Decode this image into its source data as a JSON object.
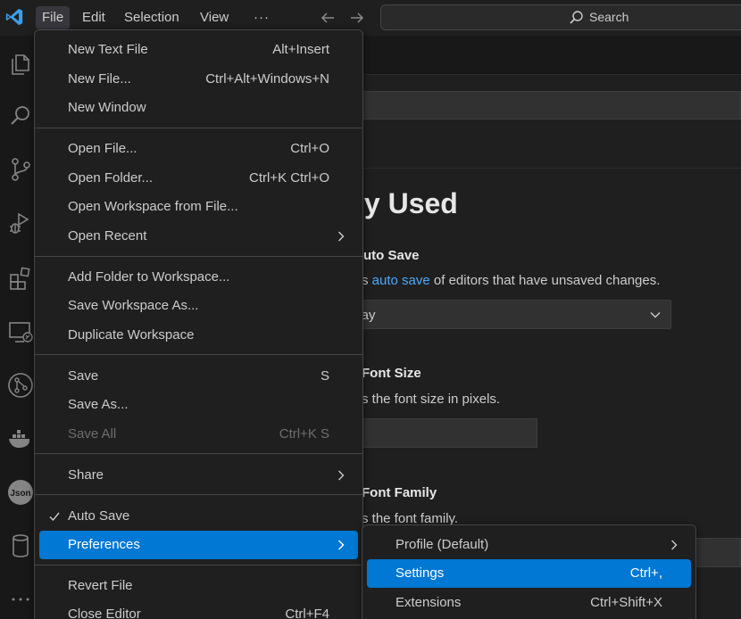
{
  "titlebar": {
    "menus": [
      "File",
      "Edit",
      "Selection",
      "View",
      "···"
    ],
    "search_label": "Search"
  },
  "editor": {
    "section_title": "mmonly Used",
    "auto_save": {
      "title": "uto Save",
      "desc_prefix": "s ",
      "desc_link": "auto save",
      "desc_suffix": " of editors that have unsaved changes.",
      "value": "elay"
    },
    "font_size": {
      "title": "Font Size",
      "desc": "s the font size in pixels."
    },
    "font_family": {
      "title": "Font Family",
      "desc": "s the font family."
    }
  },
  "file_menu": {
    "groups": [
      [
        {
          "label": "New Text File",
          "key": "Alt+Insert"
        },
        {
          "label": "New File...",
          "key": "Ctrl+Alt+Windows+N"
        },
        {
          "label": "New Window",
          "key": ""
        }
      ],
      [
        {
          "label": "Open File...",
          "key": "Ctrl+O"
        },
        {
          "label": "Open Folder...",
          "key": "Ctrl+K Ctrl+O"
        },
        {
          "label": "Open Workspace from File...",
          "key": ""
        },
        {
          "label": "Open Recent",
          "key": "",
          "submenu": true
        }
      ],
      [
        {
          "label": "Add Folder to Workspace...",
          "key": ""
        },
        {
          "label": "Save Workspace As...",
          "key": ""
        },
        {
          "label": "Duplicate Workspace",
          "key": ""
        }
      ],
      [
        {
          "label": "Save",
          "key": "S"
        },
        {
          "label": "Save As...",
          "key": ""
        },
        {
          "label": "Save All",
          "key": "Ctrl+K S",
          "disabled": true
        }
      ],
      [
        {
          "label": "Share",
          "key": "",
          "submenu": true
        }
      ],
      [
        {
          "label": "Auto Save",
          "key": "",
          "checked": true
        },
        {
          "label": "Preferences",
          "key": "",
          "submenu": true,
          "highlighted": true
        }
      ],
      [
        {
          "label": "Revert File",
          "key": ""
        },
        {
          "label": "Close Editor",
          "key": "Ctrl+F4"
        }
      ]
    ]
  },
  "preferences_menu": {
    "items": [
      {
        "label": "Profile (Default)",
        "key": "",
        "submenu": true
      },
      {
        "label": "Settings",
        "key": "Ctrl+,",
        "highlighted": true
      },
      {
        "label": "Extensions",
        "key": "Ctrl+Shift+X"
      }
    ]
  },
  "colors": {
    "accent": "#0078d4",
    "background": "#1f1f1f",
    "link": "#4daafc"
  }
}
